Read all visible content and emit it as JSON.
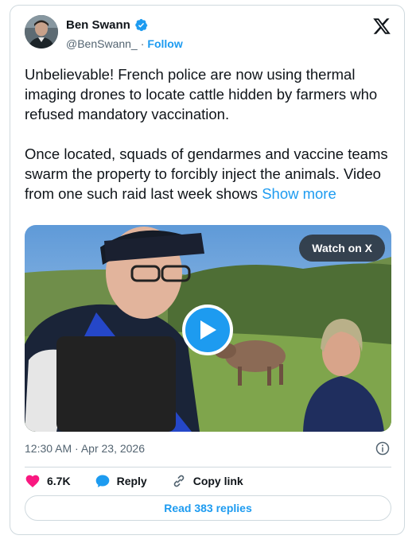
{
  "tweet": {
    "author_name": "Ben Swann",
    "handle": "@BenSwann_",
    "separator": "·",
    "follow_label": "Follow",
    "text": "Unbelievable! French police are now using thermal imaging drones to locate cattle hidden by farmers who refused mandatory vaccination.\n\nOnce located, squads of gendarmes and vaccine teams swarm the property to forcibly inject the animals. Video from one such raid last week shows ",
    "show_more_label": "Show more",
    "watch_label": "Watch on X",
    "timestamp": "12:30 AM · Apr 23, 2026",
    "likes_count": "6.7K",
    "reply_label": "Reply",
    "copy_link_label": "Copy link",
    "read_replies_label": "Read 383 replies"
  },
  "colors": {
    "accent": "#1d9bf0",
    "like": "#f91880",
    "muted": "#536471",
    "text": "#0f1419",
    "border": "#cfd9de"
  },
  "icons": [
    "verified-badge-icon",
    "x-logo-icon",
    "play-icon",
    "info-icon",
    "heart-icon",
    "reply-bubble-icon",
    "link-icon"
  ]
}
